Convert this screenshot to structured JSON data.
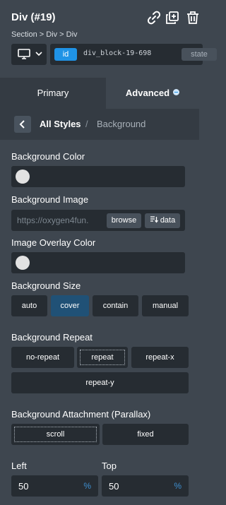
{
  "header": {
    "title": "Div (#19)",
    "icons": [
      "link-icon",
      "duplicate-icon",
      "trash-icon"
    ],
    "breadcrumb": "Section > Div > Div",
    "device_icon": "desktop-monitor-icon",
    "selector": {
      "badge": "id",
      "value": "div_block-19-698",
      "state_label": "state"
    }
  },
  "tabs": [
    {
      "label": "Primary",
      "active": false
    },
    {
      "label": "Advanced",
      "active": true
    }
  ],
  "subnav": {
    "back_icon": "chevron-left-icon",
    "root": "All Styles",
    "separator": "/",
    "current": "Background"
  },
  "background_color": {
    "label": "Background Color",
    "value": "#e2e2e2"
  },
  "background_image": {
    "label": "Background Image",
    "url": "https://oxygen4fun.",
    "browse_label": "browse",
    "data_label": "data",
    "data_icon": "dynamic-data-icon"
  },
  "overlay_color": {
    "label": "Image Overlay Color",
    "value": "#e2e2e2"
  },
  "background_size": {
    "label": "Background Size",
    "options": [
      "auto",
      "cover",
      "contain",
      "manual"
    ],
    "selected": "cover"
  },
  "background_repeat": {
    "label": "Background Repeat",
    "options": [
      "no-repeat",
      "repeat",
      "repeat-x",
      "repeat-y"
    ],
    "focused": "repeat"
  },
  "background_attachment": {
    "label": "Background Attachment (Parallax)",
    "options": [
      "scroll",
      "fixed"
    ],
    "focused": "scroll"
  },
  "position": {
    "left": {
      "label": "Left",
      "value": "50",
      "unit": "%"
    },
    "top": {
      "label": "Top",
      "value": "50",
      "unit": "%"
    }
  },
  "colors": {
    "panel_bg": "#3e464f",
    "input_bg": "#262c32",
    "accent": "#1f93e6",
    "active_option": "#205176"
  }
}
